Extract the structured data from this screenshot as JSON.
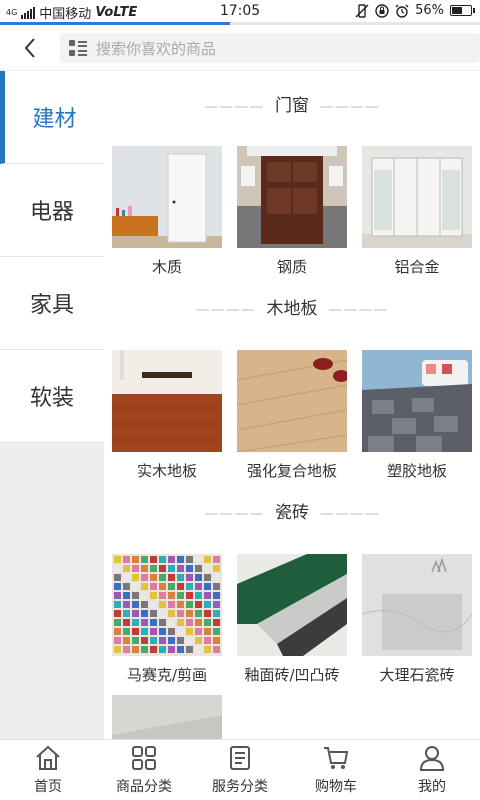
{
  "status_bar": {
    "network_type": "4G",
    "carrier": "中国移动",
    "volte": "VoLTE",
    "time": "17:05",
    "battery": "56%",
    "battery_level": 0.56
  },
  "page_load_progress": 0.48,
  "header": {
    "search_placeholder": "搜索你喜欢的商品"
  },
  "sidebar": {
    "categories": [
      {
        "label": "建材",
        "active": true
      },
      {
        "label": "电器",
        "active": false
      },
      {
        "label": "家具",
        "active": false
      },
      {
        "label": "软装",
        "active": false
      }
    ]
  },
  "sections": [
    {
      "title": "门窗",
      "items": [
        {
          "label": "木质"
        },
        {
          "label": "钢质"
        },
        {
          "label": "铝合金"
        }
      ]
    },
    {
      "title": "木地板",
      "items": [
        {
          "label": "实木地板"
        },
        {
          "label": "强化复合地板"
        },
        {
          "label": "塑胶地板"
        }
      ]
    },
    {
      "title": "瓷砖",
      "items": [
        {
          "label": "马赛克/剪画"
        },
        {
          "label": "釉面砖/凹凸砖"
        },
        {
          "label": "大理石瓷砖"
        }
      ]
    }
  ],
  "bottom_nav": [
    {
      "label": "首页",
      "icon": "home-icon"
    },
    {
      "label": "商品分类",
      "icon": "grid-icon"
    },
    {
      "label": "服务分类",
      "icon": "document-icon"
    },
    {
      "label": "购物车",
      "icon": "cart-icon"
    },
    {
      "label": "我的",
      "icon": "user-icon"
    }
  ]
}
